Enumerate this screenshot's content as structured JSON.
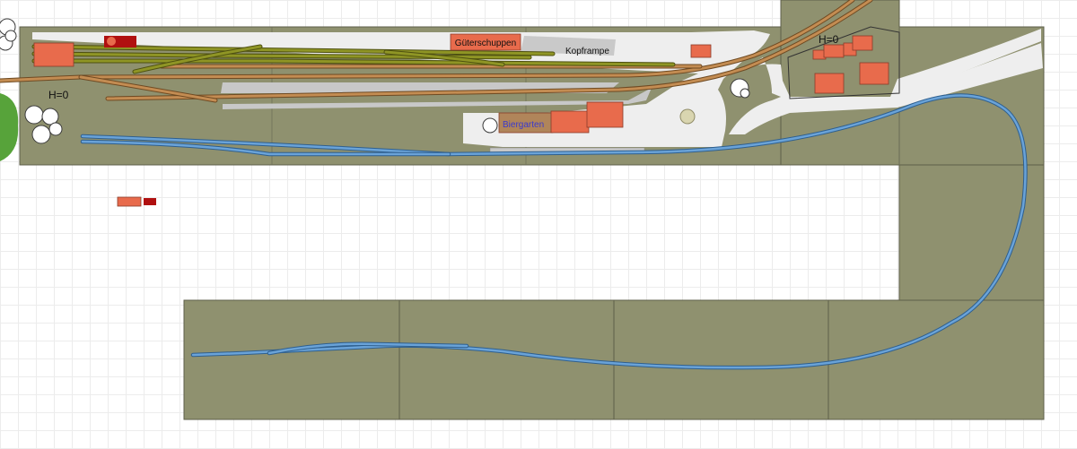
{
  "labels": {
    "gueterschuppen": "Güterschuppen",
    "kopframpe": "Kopframpe",
    "biergarten": "Biergarten",
    "height_left": "H=0",
    "height_right": "H=0"
  },
  "colors": {
    "baseboard": "#8f916f",
    "baseboard_edge": "#5d5e48",
    "platform": "#eeeeee",
    "platform_grey": "#c8c8c8",
    "building": "#e86b4c",
    "vehicle_red": "#b01010",
    "track_brown": "#b7824d",
    "track_olive": "#8a8e20",
    "track_blue": "#4f8dc9",
    "green_patch": "#57a33a",
    "biergarten_text": "#3a3acc"
  }
}
